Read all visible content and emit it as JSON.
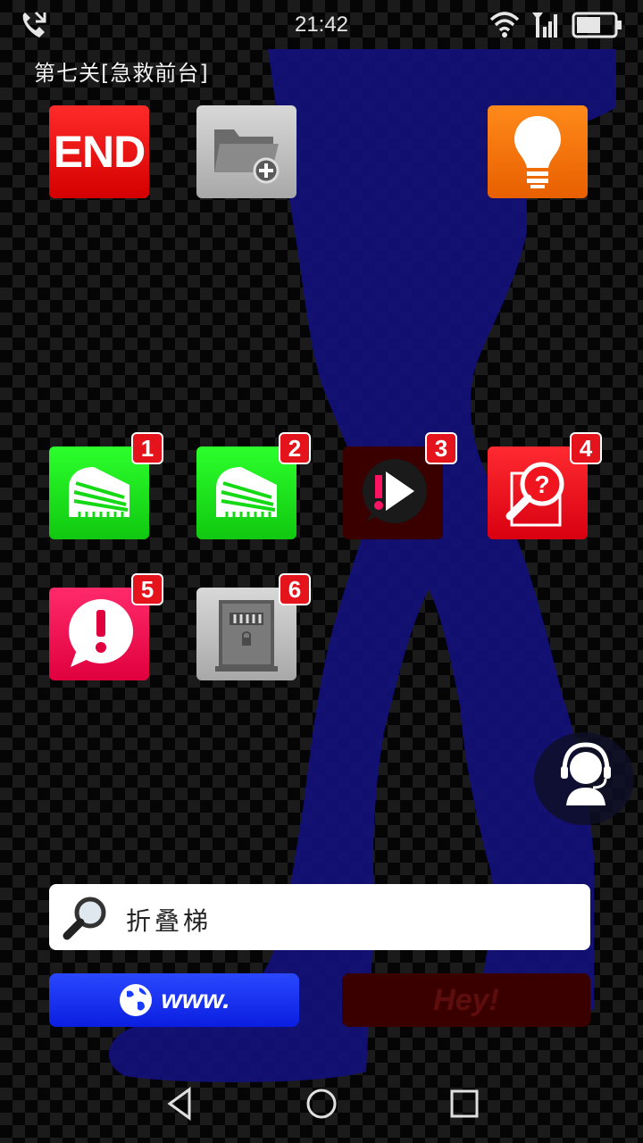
{
  "status_bar": {
    "time": "21:42",
    "icons": [
      "missed-call-icon",
      "wifi-icon",
      "signal-icon",
      "battery-icon"
    ]
  },
  "level": {
    "title": "第七关[急救前台]"
  },
  "top_tools": [
    {
      "name": "end-button",
      "label": "END",
      "color": "#e5141c"
    },
    {
      "name": "folder-add-button",
      "icon": "folder-plus-icon",
      "color": "#bdbdbd"
    },
    {
      "name": "hint-button",
      "icon": "lightbulb-icon",
      "color": "#ff7a00"
    }
  ],
  "apps": [
    {
      "badge": "1",
      "icon": "stadium-icon",
      "color": "#16d916"
    },
    {
      "badge": "2",
      "icon": "stadium-icon",
      "color": "#16d916"
    },
    {
      "badge": "3",
      "icon": "alert-play-icon",
      "color": "#3a0000"
    },
    {
      "badge": "4",
      "icon": "search-question-icon",
      "color": "#f0141e"
    },
    {
      "badge": "5",
      "icon": "alert-bubble-icon",
      "color": "#f0145a"
    },
    {
      "badge": "6",
      "icon": "locked-door-icon",
      "color": "#bdbdbd"
    }
  ],
  "search": {
    "value": "折叠梯",
    "icon": "search-icon"
  },
  "buttons": {
    "www_label": "www.",
    "hey_label": "Hey!"
  },
  "assistant": {
    "icon": "headset-agent-icon"
  },
  "nav": [
    "back-icon",
    "home-icon",
    "recents-icon"
  ]
}
